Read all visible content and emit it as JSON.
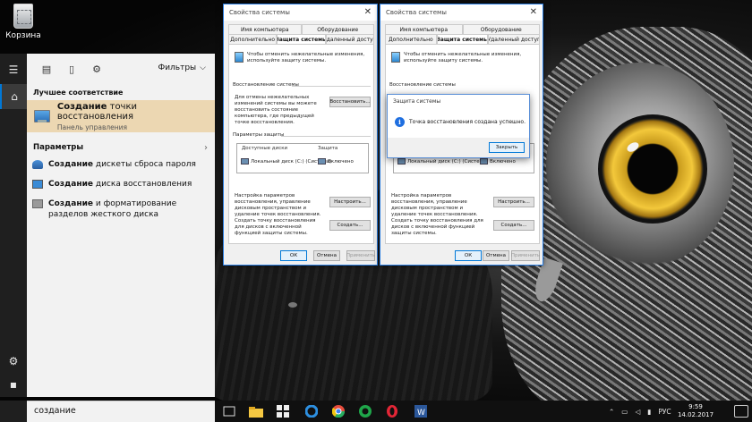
{
  "desktop": {
    "recycle_bin_label": "Корзина"
  },
  "start": {
    "filters_label": "Фильтры",
    "best_match_heading": "Лучшее соответствие",
    "best_match": {
      "title_bold": "Создание",
      "title_rest": " точки восстановления",
      "subtitle": "Панель управления"
    },
    "params_heading": "Параметры",
    "params": [
      {
        "bold": "Создание",
        "rest": " дискеты сброса пароля"
      },
      {
        "bold": "Создание",
        "rest": " диска восстановления"
      },
      {
        "bold": "Создание",
        "rest": " и форматирование разделов жесткого диска"
      }
    ],
    "search_value": "создание"
  },
  "window1": {
    "title": "Свойства системы",
    "tabs_row1": [
      "Имя компьютера",
      "Оборудование"
    ],
    "tabs_row2": [
      "Дополнительно",
      "Защита системы",
      "Удаленный доступ"
    ],
    "intro": "Чтобы отменить нежелательные изменения, используйте защиту системы.",
    "restore_group": "Восстановление системы",
    "restore_text": "Для отмены нежелательных изменений системы вы можете восстановить состояние компьютера, где предыдущей точке восстановления.",
    "restore_button": "Восстановить...",
    "protect_group": "Параметры защиты",
    "col_disks": "Доступные диски",
    "col_protect": "Защита",
    "disk_name": "Локальный диск (C:) (Система)",
    "disk_state": "Включено",
    "config_text": "Настройка параметров восстановления, управление дисковым пространством и удаление точек восстановления.",
    "config_button": "Настроить...",
    "create_text": "Создать точку восстановления для дисков с включенной функцией защиты системы.",
    "create_button": "Создать...",
    "ok": "ОК",
    "cancel": "Отмена",
    "apply": "Применить"
  },
  "window2": {
    "title": "Свойства системы",
    "tabs_row1": [
      "Имя компьютера",
      "Оборудование"
    ],
    "tabs_row2": [
      "Дополнительно",
      "Защита системы",
      "Удаленный доступ"
    ],
    "intro": "Чтобы отменить нежелательные изменения, используйте защиту системы.",
    "restore_group": "Восстановление системы",
    "disk_name": "Локальный диск (C:) (Система)",
    "disk_state": "Включено",
    "config_text": "Настройка параметров восстановления, управление дисковым пространством и удаление точек восстановления.",
    "config_button": "Настроить...",
    "create_text": "Создать точку восстановления для дисков с включенной функцией защиты системы.",
    "create_button": "Создать...",
    "ok": "ОК",
    "cancel": "Отмена",
    "apply": "Применить"
  },
  "dialog": {
    "title": "Защита системы",
    "message": "Точка восстановления создана успешно.",
    "close_button": "Закрыть"
  },
  "taskbar": {
    "language": "РУС",
    "time": "9:59",
    "date": "14.02.2017"
  },
  "colors": {
    "accent": "#0078d7",
    "best_match_bg": "#ecd7b2",
    "taskbar": "#101010"
  }
}
